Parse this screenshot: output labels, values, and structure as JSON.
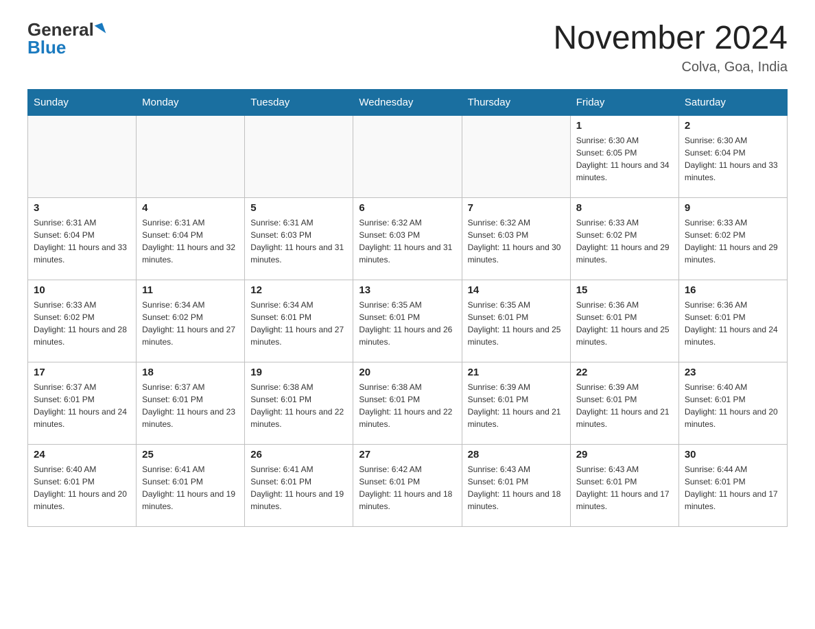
{
  "header": {
    "logo_general": "General",
    "logo_blue": "Blue",
    "title": "November 2024",
    "subtitle": "Colva, Goa, India"
  },
  "days_of_week": [
    "Sunday",
    "Monday",
    "Tuesday",
    "Wednesday",
    "Thursday",
    "Friday",
    "Saturday"
  ],
  "weeks": [
    [
      {
        "day": "",
        "sunrise": "",
        "sunset": "",
        "daylight": ""
      },
      {
        "day": "",
        "sunrise": "",
        "sunset": "",
        "daylight": ""
      },
      {
        "day": "",
        "sunrise": "",
        "sunset": "",
        "daylight": ""
      },
      {
        "day": "",
        "sunrise": "",
        "sunset": "",
        "daylight": ""
      },
      {
        "day": "",
        "sunrise": "",
        "sunset": "",
        "daylight": ""
      },
      {
        "day": "1",
        "sunrise": "Sunrise: 6:30 AM",
        "sunset": "Sunset: 6:05 PM",
        "daylight": "Daylight: 11 hours and 34 minutes."
      },
      {
        "day": "2",
        "sunrise": "Sunrise: 6:30 AM",
        "sunset": "Sunset: 6:04 PM",
        "daylight": "Daylight: 11 hours and 33 minutes."
      }
    ],
    [
      {
        "day": "3",
        "sunrise": "Sunrise: 6:31 AM",
        "sunset": "Sunset: 6:04 PM",
        "daylight": "Daylight: 11 hours and 33 minutes."
      },
      {
        "day": "4",
        "sunrise": "Sunrise: 6:31 AM",
        "sunset": "Sunset: 6:04 PM",
        "daylight": "Daylight: 11 hours and 32 minutes."
      },
      {
        "day": "5",
        "sunrise": "Sunrise: 6:31 AM",
        "sunset": "Sunset: 6:03 PM",
        "daylight": "Daylight: 11 hours and 31 minutes."
      },
      {
        "day": "6",
        "sunrise": "Sunrise: 6:32 AM",
        "sunset": "Sunset: 6:03 PM",
        "daylight": "Daylight: 11 hours and 31 minutes."
      },
      {
        "day": "7",
        "sunrise": "Sunrise: 6:32 AM",
        "sunset": "Sunset: 6:03 PM",
        "daylight": "Daylight: 11 hours and 30 minutes."
      },
      {
        "day": "8",
        "sunrise": "Sunrise: 6:33 AM",
        "sunset": "Sunset: 6:02 PM",
        "daylight": "Daylight: 11 hours and 29 minutes."
      },
      {
        "day": "9",
        "sunrise": "Sunrise: 6:33 AM",
        "sunset": "Sunset: 6:02 PM",
        "daylight": "Daylight: 11 hours and 29 minutes."
      }
    ],
    [
      {
        "day": "10",
        "sunrise": "Sunrise: 6:33 AM",
        "sunset": "Sunset: 6:02 PM",
        "daylight": "Daylight: 11 hours and 28 minutes."
      },
      {
        "day": "11",
        "sunrise": "Sunrise: 6:34 AM",
        "sunset": "Sunset: 6:02 PM",
        "daylight": "Daylight: 11 hours and 27 minutes."
      },
      {
        "day": "12",
        "sunrise": "Sunrise: 6:34 AM",
        "sunset": "Sunset: 6:01 PM",
        "daylight": "Daylight: 11 hours and 27 minutes."
      },
      {
        "day": "13",
        "sunrise": "Sunrise: 6:35 AM",
        "sunset": "Sunset: 6:01 PM",
        "daylight": "Daylight: 11 hours and 26 minutes."
      },
      {
        "day": "14",
        "sunrise": "Sunrise: 6:35 AM",
        "sunset": "Sunset: 6:01 PM",
        "daylight": "Daylight: 11 hours and 25 minutes."
      },
      {
        "day": "15",
        "sunrise": "Sunrise: 6:36 AM",
        "sunset": "Sunset: 6:01 PM",
        "daylight": "Daylight: 11 hours and 25 minutes."
      },
      {
        "day": "16",
        "sunrise": "Sunrise: 6:36 AM",
        "sunset": "Sunset: 6:01 PM",
        "daylight": "Daylight: 11 hours and 24 minutes."
      }
    ],
    [
      {
        "day": "17",
        "sunrise": "Sunrise: 6:37 AM",
        "sunset": "Sunset: 6:01 PM",
        "daylight": "Daylight: 11 hours and 24 minutes."
      },
      {
        "day": "18",
        "sunrise": "Sunrise: 6:37 AM",
        "sunset": "Sunset: 6:01 PM",
        "daylight": "Daylight: 11 hours and 23 minutes."
      },
      {
        "day": "19",
        "sunrise": "Sunrise: 6:38 AM",
        "sunset": "Sunset: 6:01 PM",
        "daylight": "Daylight: 11 hours and 22 minutes."
      },
      {
        "day": "20",
        "sunrise": "Sunrise: 6:38 AM",
        "sunset": "Sunset: 6:01 PM",
        "daylight": "Daylight: 11 hours and 22 minutes."
      },
      {
        "day": "21",
        "sunrise": "Sunrise: 6:39 AM",
        "sunset": "Sunset: 6:01 PM",
        "daylight": "Daylight: 11 hours and 21 minutes."
      },
      {
        "day": "22",
        "sunrise": "Sunrise: 6:39 AM",
        "sunset": "Sunset: 6:01 PM",
        "daylight": "Daylight: 11 hours and 21 minutes."
      },
      {
        "day": "23",
        "sunrise": "Sunrise: 6:40 AM",
        "sunset": "Sunset: 6:01 PM",
        "daylight": "Daylight: 11 hours and 20 minutes."
      }
    ],
    [
      {
        "day": "24",
        "sunrise": "Sunrise: 6:40 AM",
        "sunset": "Sunset: 6:01 PM",
        "daylight": "Daylight: 11 hours and 20 minutes."
      },
      {
        "day": "25",
        "sunrise": "Sunrise: 6:41 AM",
        "sunset": "Sunset: 6:01 PM",
        "daylight": "Daylight: 11 hours and 19 minutes."
      },
      {
        "day": "26",
        "sunrise": "Sunrise: 6:41 AM",
        "sunset": "Sunset: 6:01 PM",
        "daylight": "Daylight: 11 hours and 19 minutes."
      },
      {
        "day": "27",
        "sunrise": "Sunrise: 6:42 AM",
        "sunset": "Sunset: 6:01 PM",
        "daylight": "Daylight: 11 hours and 18 minutes."
      },
      {
        "day": "28",
        "sunrise": "Sunrise: 6:43 AM",
        "sunset": "Sunset: 6:01 PM",
        "daylight": "Daylight: 11 hours and 18 minutes."
      },
      {
        "day": "29",
        "sunrise": "Sunrise: 6:43 AM",
        "sunset": "Sunset: 6:01 PM",
        "daylight": "Daylight: 11 hours and 17 minutes."
      },
      {
        "day": "30",
        "sunrise": "Sunrise: 6:44 AM",
        "sunset": "Sunset: 6:01 PM",
        "daylight": "Daylight: 11 hours and 17 minutes."
      }
    ]
  ]
}
